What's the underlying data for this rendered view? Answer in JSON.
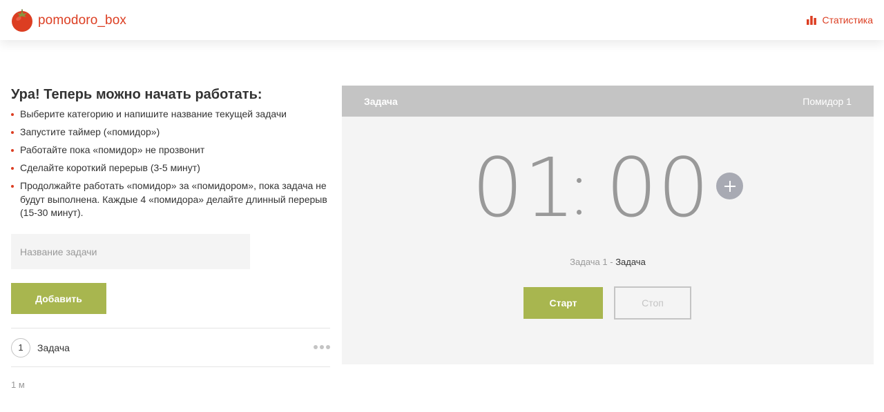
{
  "header": {
    "logo_text": "pomodoro_box",
    "stats_label": "Статистика",
    "logo_icon": "tomato-icon",
    "stats_icon": "bar-chart-icon"
  },
  "instructions": {
    "title": "Ура! Теперь можно начать работать:",
    "items": [
      "Выберите категорию и напишите название текущей задачи",
      "Запустите таймер («помидор»)",
      "Работайте пока «помидор» не прозвонит",
      "Сделайте короткий перерыв (3-5 минут)",
      "Продолжайте работать «помидор» за «помидором», пока задача не будут выполнена. Каждые 4 «помидора» делайте длинный перерыв (15-30 минут)."
    ]
  },
  "form": {
    "input_placeholder": "Название задачи",
    "input_value": "",
    "add_label": "Добавить"
  },
  "tasks": [
    {
      "count": "1",
      "name": "Задача",
      "menu_icon": "more-dots-icon"
    }
  ],
  "total_time": "1 м",
  "timer": {
    "header_task": "Задача",
    "header_pomodoro": "Помидор 1",
    "minutes": "01",
    "seconds": "00",
    "add_icon": "plus-icon",
    "caption_prefix": "Задача 1 - ",
    "caption_task": "Задача",
    "start_label": "Старт",
    "stop_label": "Стоп"
  },
  "colors": {
    "accent_red": "#dc3e22",
    "accent_green": "#a8b64f",
    "panel_header": "#c4c4c4",
    "panel_bg": "#f4f4f4"
  }
}
